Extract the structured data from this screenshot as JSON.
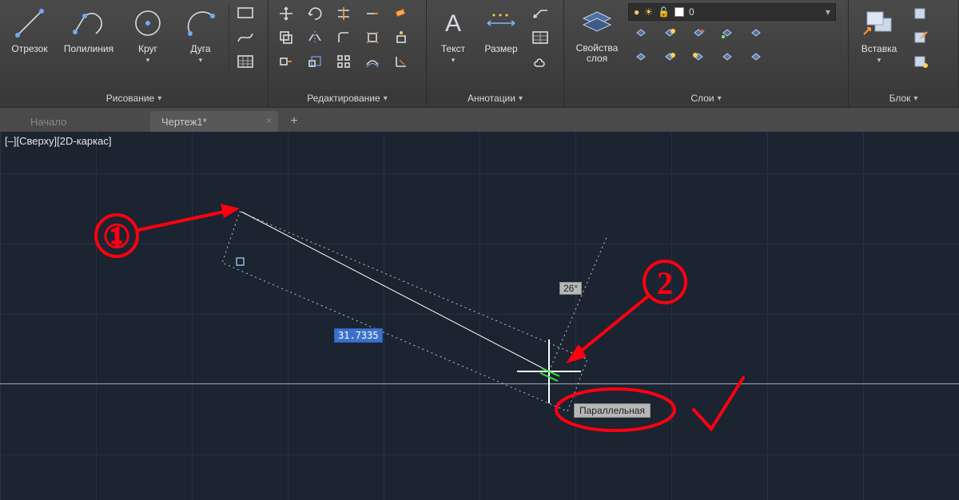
{
  "ribbon": {
    "draw": {
      "title": "Рисование",
      "tools": {
        "line": "Отрезок",
        "polyline": "Полилиния",
        "circle": "Круг",
        "arc": "Дуга"
      }
    },
    "modify": {
      "title": "Редактирование"
    },
    "annotate": {
      "title": "Аннотации",
      "text": "Текст",
      "dimension": "Размер"
    },
    "layers": {
      "title": "Слои",
      "prop": "Свойства\nслоя",
      "prop_line1": "Свойства",
      "prop_line2": "слоя",
      "current": "0"
    },
    "block": {
      "title": "Блок",
      "insert": "Вставка"
    }
  },
  "tabs": {
    "home": "Начало",
    "dwg": "Чертеж1*"
  },
  "view_label": "[–][Сверху][2D-каркас]",
  "dynamic": {
    "length": "31.7335",
    "angle": "26°"
  },
  "tooltip": "Параллельная",
  "callouts": {
    "one": "1",
    "two": "2"
  }
}
